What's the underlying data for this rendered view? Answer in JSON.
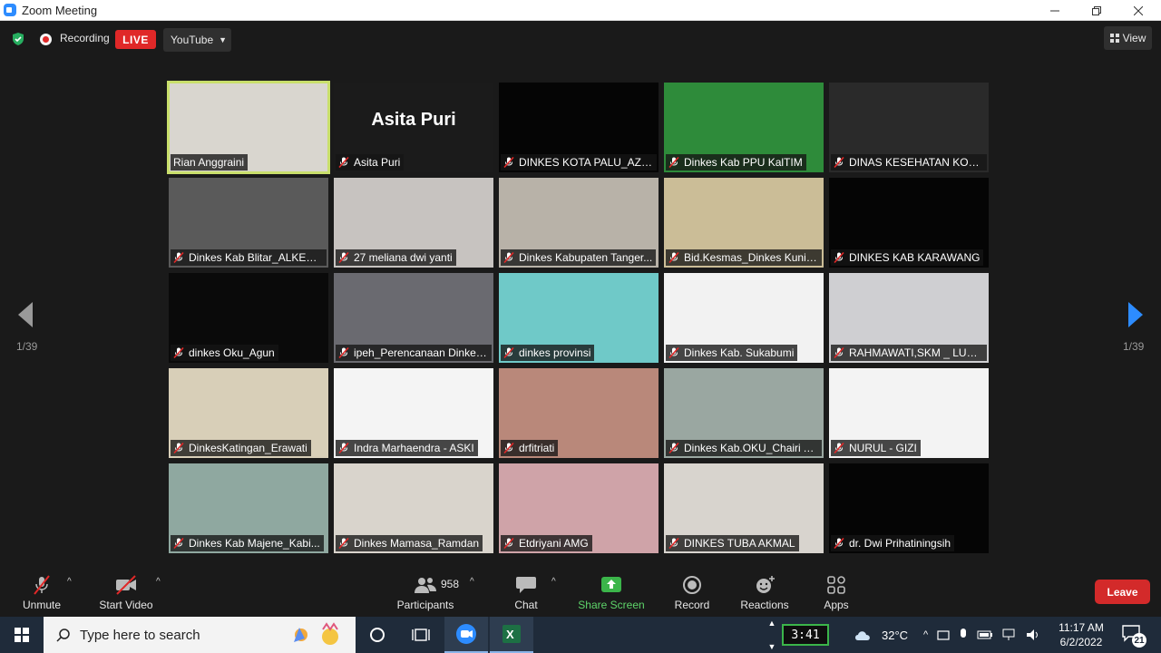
{
  "window": {
    "title": "Zoom Meeting"
  },
  "topbar": {
    "recording_label": "Recording",
    "live_label": "LIVE",
    "stream_target": "YouTube",
    "view_label": "View"
  },
  "colors": {
    "accent": "#2d8cff",
    "live_red": "#e02828",
    "leave_red": "#d32a2a",
    "share_green": "#5ed46a",
    "active_speaker": "#c9df6b"
  },
  "grid": {
    "tiles": [
      {
        "name": "Rian Anggraini",
        "muted": false,
        "active": true
      },
      {
        "name": "Asita Puri",
        "muted": true,
        "title_text": "Asita Puri"
      },
      {
        "name": "DINKES KOTA PALU_AZR...",
        "muted": true
      },
      {
        "name": "Dinkes Kab PPU KalTIM",
        "muted": true
      },
      {
        "name": "DINAS KESEHATAN KOTA ...",
        "muted": true
      },
      {
        "name": "Dinkes Kab Blitar_ALKES ...",
        "muted": true
      },
      {
        "name": "27 meliana dwi yanti",
        "muted": true
      },
      {
        "name": "Dinkes Kabupaten Tanger...",
        "muted": true
      },
      {
        "name": "Bid.Kesmas_Dinkes Kunin...",
        "muted": true
      },
      {
        "name": "DINKES KAB KARAWANG",
        "muted": true
      },
      {
        "name": "dinkes Oku_Agun",
        "muted": true
      },
      {
        "name": "ipeh_Perencanaan Dinkes...",
        "muted": true
      },
      {
        "name": "dinkes provinsi",
        "muted": true
      },
      {
        "name": "Dinkes Kab. Sukabumi",
        "muted": true
      },
      {
        "name": "RAHMAWATI,SKM _ LUW...",
        "muted": true
      },
      {
        "name": "DinkesKatingan_Erawati",
        "muted": true
      },
      {
        "name": "Indra Marhaendra - ASKI",
        "muted": true
      },
      {
        "name": "drfitriati",
        "muted": true
      },
      {
        "name": "Dinkes Kab.OKU_Chairi A...",
        "muted": true
      },
      {
        "name": "NURUL - GIZI",
        "muted": true
      },
      {
        "name": "Dinkes Kab Majene_Kabi...",
        "muted": true
      },
      {
        "name": "Dinkes Mamasa_Ramdan",
        "muted": true
      },
      {
        "name": "Etdriyani AMG",
        "muted": true
      },
      {
        "name": "DINKES TUBA AKMAL",
        "muted": true
      },
      {
        "name": "dr. Dwi Prihatiningsih",
        "muted": true
      }
    ],
    "page_left": "1/39",
    "page_right": "1/39"
  },
  "toolbar": {
    "unmute": "Unmute",
    "start_video": "Start Video",
    "participants_count": "958",
    "participants": "Participants",
    "chat": "Chat",
    "share_screen": "Share Screen",
    "record": "Record",
    "reactions": "Reactions",
    "apps": "Apps",
    "leave": "Leave"
  },
  "taskbar": {
    "search_placeholder": "Type here to search",
    "timer": "3:41",
    "temperature": "32°C",
    "time": "11:17 AM",
    "date": "6/2/2022",
    "notifications": "21"
  }
}
